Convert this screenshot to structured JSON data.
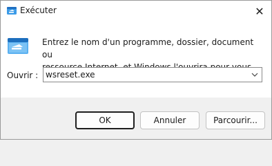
{
  "window": {
    "title": "Exécuter",
    "close_glyph": "✕"
  },
  "dialog": {
    "description_line1": "Entrez le nom d'un programme, dossier, document ou",
    "description_line2": "ressource Internet, et Windows l'ouvrira pour vous.",
    "open_label": "Ouvrir :",
    "command_value": "wsreset.exe"
  },
  "buttons": {
    "ok": "OK",
    "cancel": "Annuler",
    "browse": "Parcourir..."
  },
  "icons": {
    "app": "run-app-icon",
    "run": "run-dialog-icon",
    "dropdown": "chevron-down-icon",
    "close": "close-icon"
  },
  "colors": {
    "accent": "#0078d4",
    "body_bg": "#ffffff",
    "footer_bg": "#f0f0f0"
  }
}
